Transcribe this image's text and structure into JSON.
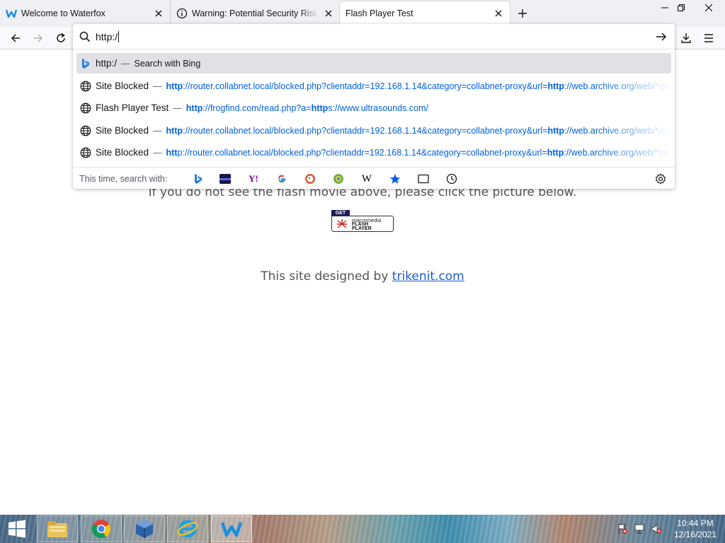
{
  "tabs": [
    {
      "title": "Welcome to Waterfox",
      "icon": "waterfox-icon"
    },
    {
      "title": "Warning: Potential Security Risk Ahead",
      "icon": "info-icon"
    },
    {
      "title": "Flash Player Test",
      "icon": "none"
    }
  ],
  "urlbar": {
    "value": "http:/"
  },
  "results": [
    {
      "type": "search",
      "text": "http:/",
      "sep": "—",
      "action": "Search with Bing"
    },
    {
      "type": "history",
      "title": "Site Blocked",
      "sep": "—",
      "url_bold": "http",
      "url_rest": "://router.collabnet.local/blocked.php?clientaddr=192.168.1.14&category=collabnet-proxy&url=",
      "url_bold2": "http",
      "url_rest2": "://web.archive.org/web/*/pill"
    },
    {
      "type": "history",
      "title": "Flash Player Test",
      "sep": "—",
      "url_bold": "http",
      "url_rest": "://frogfind.com/read.php?a=",
      "url_bold2": "http",
      "url_bold2_suffix": "s",
      "url_rest2": "://www.ultrasounds.com/"
    },
    {
      "type": "history",
      "title": "Site Blocked",
      "sep": "—",
      "url_bold": "http",
      "url_rest": "://router.collabnet.local/blocked.php?clientaddr=192.168.1.14&category=collabnet-proxy&url=",
      "url_bold2": "http",
      "url_rest2": "://web.archive.org/web/*/pill"
    },
    {
      "type": "history",
      "title": "Site Blocked",
      "sep": "—",
      "url_bold": "htt",
      "url_rest": "p://router.collabnet.local/blocked.php?clientaddr=192.168.1.14&category=collabnet-proxy&url=",
      "url_bold2": "http",
      "url_rest2": "://web.archive.org/web/*/pill"
    }
  ],
  "oneoff": {
    "label": "This time, search with:",
    "engines": [
      "bing",
      "bookmark-bar",
      "yahoo",
      "google",
      "duckduckgo",
      "ecosia",
      "wikipedia",
      "bookmarks",
      "tabs",
      "history"
    ]
  },
  "page": {
    "line1": "If you do not see the flash movie above, please click the picture below.",
    "badge_get": "GET",
    "badge_mm": "macromedia",
    "badge_flash": "FLASH",
    "badge_player": "PLAYER",
    "designed_prefix": "This site designed by ",
    "designed_link": "trikenit.com"
  },
  "clock": {
    "time": "10:44 PM",
    "date": "12/16/2021"
  },
  "colors": {
    "accent": "#0060df",
    "tabstrip": "#f0f0f4",
    "selected_result": "#e0e0e6"
  }
}
